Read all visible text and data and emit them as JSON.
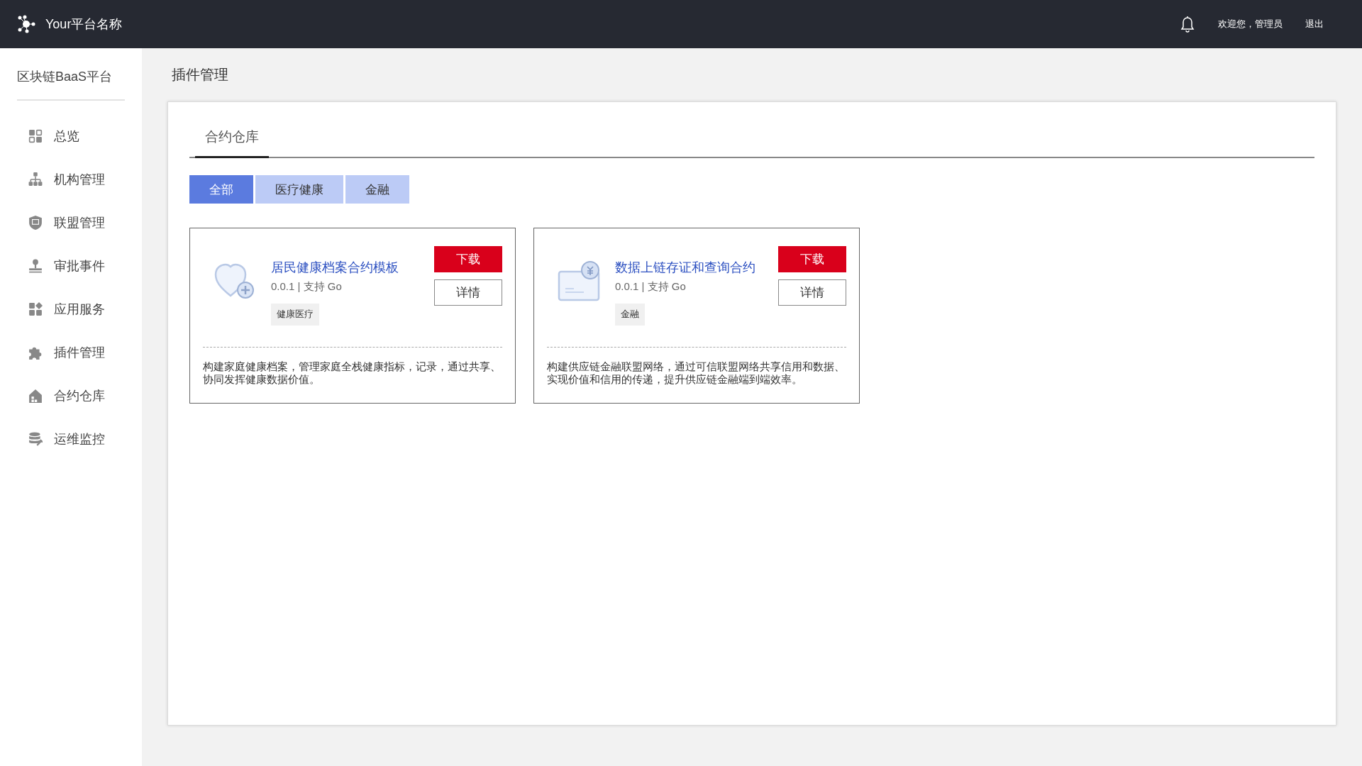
{
  "header": {
    "brand": "Your平台名称",
    "welcome": "欢迎您，管理员",
    "logout": "退出"
  },
  "sidebar": {
    "title": "区块链BaaS平台",
    "items": [
      {
        "label": "总览",
        "selected": false
      },
      {
        "label": "机构管理",
        "selected": false
      },
      {
        "label": "联盟管理",
        "selected": false
      },
      {
        "label": "审批事件",
        "selected": false
      },
      {
        "label": "应用服务",
        "selected": false
      },
      {
        "label": "插件管理",
        "selected": false
      },
      {
        "label": "合约仓库",
        "selected": false
      },
      {
        "label": "运维监控",
        "selected": false
      }
    ]
  },
  "page_title": "插件管理",
  "tabs": [
    {
      "label": "合约仓库",
      "selected": true
    }
  ],
  "filters": [
    {
      "label": "全部",
      "selected": true
    },
    {
      "label": "医疗健康",
      "selected": false
    },
    {
      "label": "金融",
      "selected": false
    }
  ],
  "contracts": [
    {
      "name": "居民健康档案合约模板",
      "meta": "0.0.1 | 支持 Go",
      "tag": "健康医疗",
      "download": "下载",
      "details": "详情",
      "description": "构建家庭健康档案，管理家庭全栈健康指标，记录，通过共享、协同发挥健康数据价值。"
    },
    {
      "name": "数据上链存证和查询合约",
      "meta": "0.0.1 | 支持 Go",
      "tag": "金融",
      "download": "下载",
      "details": "详情",
      "description": "构建供应链金融联盟网络，通过可信联盟网络共享信用和数据、实现价值和信用的传递，提升供应链金融端到端效率。"
    }
  ]
}
